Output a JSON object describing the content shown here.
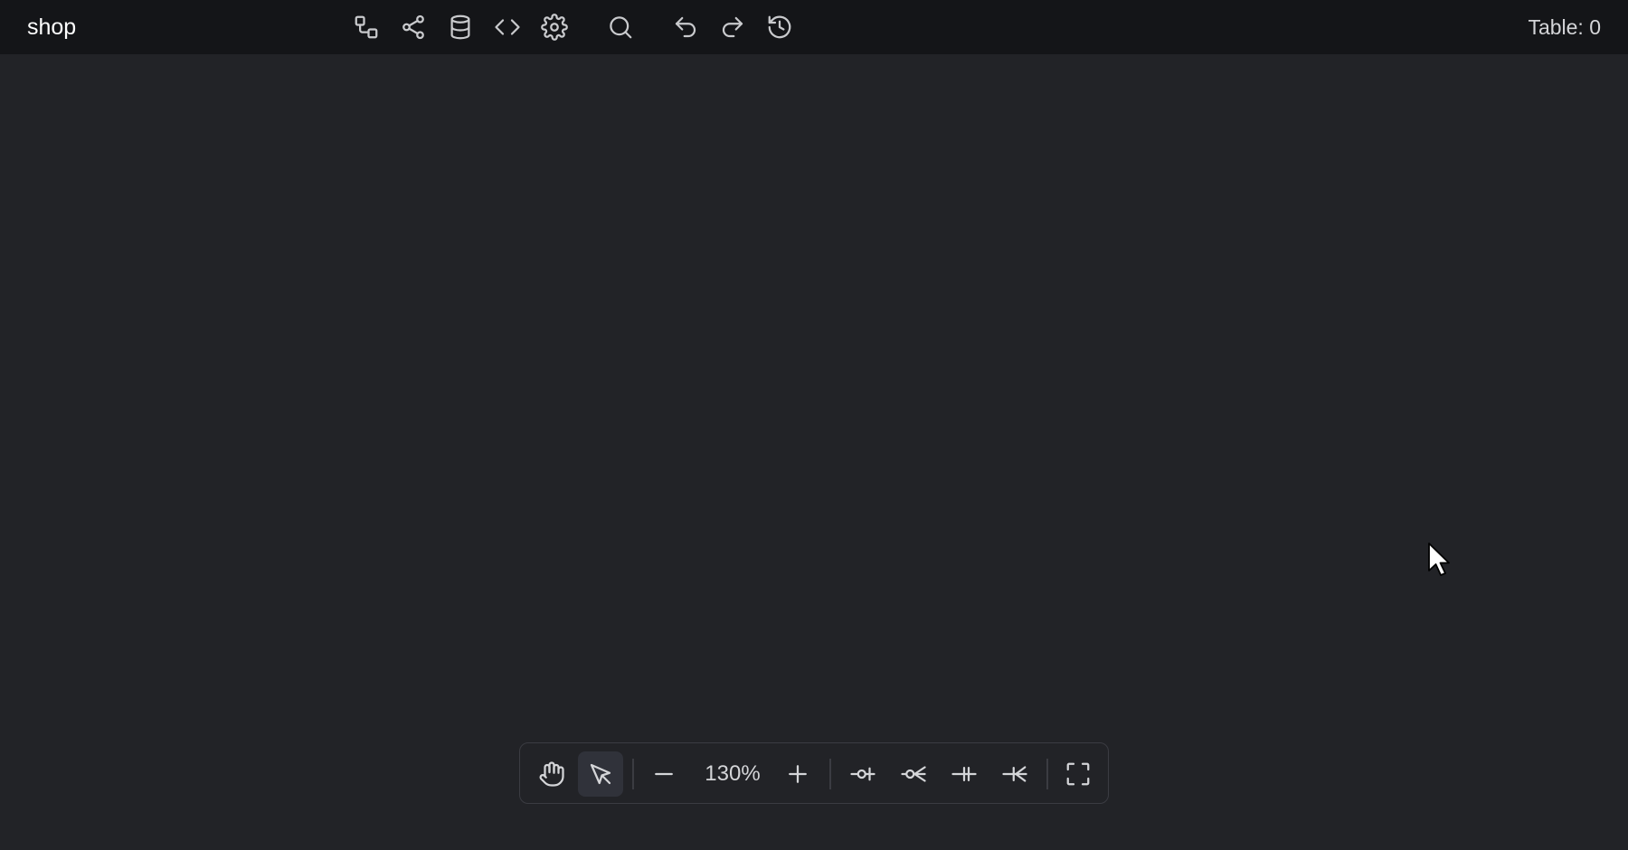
{
  "app": {
    "title": "shop",
    "table_count": "Table: 0"
  },
  "topbar": {
    "tools": [
      {
        "icon": "diagram-icon",
        "label": "Diagram"
      },
      {
        "icon": "share-icon",
        "label": "Share"
      },
      {
        "icon": "database-icon",
        "label": "Database"
      },
      {
        "icon": "code-icon",
        "label": "Code"
      },
      {
        "icon": "settings-icon",
        "label": "Settings"
      },
      {
        "icon": "search-icon",
        "label": "Search"
      },
      {
        "icon": "undo-icon",
        "label": "Undo"
      },
      {
        "icon": "redo-icon",
        "label": "Redo"
      },
      {
        "icon": "history-icon",
        "label": "History"
      }
    ]
  },
  "bottom_toolbar": {
    "active_tool": "select",
    "tools": [
      {
        "icon": "hand-icon",
        "label": "Pan"
      },
      {
        "icon": "pointer-icon",
        "label": "Select"
      },
      {
        "icon": "zoom-out-icon",
        "label": "Zoom out"
      },
      {
        "icon": "zoom-in-icon",
        "label": "Zoom in"
      },
      {
        "icon": "relation-one-icon",
        "label": "Relation one"
      },
      {
        "icon": "relation-many-icon",
        "label": "Relation many"
      },
      {
        "icon": "relation-one-mandatory-icon",
        "label": "Relation one mandatory"
      },
      {
        "icon": "relation-many-mandatory-icon",
        "label": "Relation many mandatory"
      },
      {
        "icon": "fullscreen-icon",
        "label": "Fullscreen"
      }
    ],
    "zoom_level": "130%"
  },
  "colors": {
    "topbar_bg": "#141518",
    "canvas_bg": "#222327",
    "toolbar_border": "#3b3c42",
    "active_tool_bg": "#30323a",
    "icon": "#c9cacd"
  }
}
